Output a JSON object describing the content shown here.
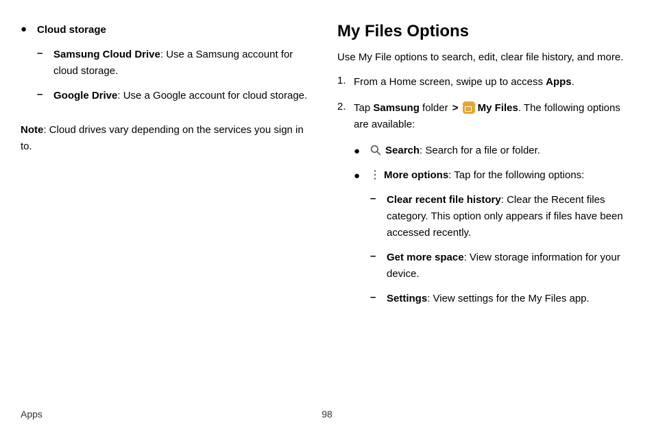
{
  "left": {
    "cloudStorage": {
      "heading": "Cloud storage",
      "items": [
        {
          "bold": "Samsung Cloud Drive",
          "rest": ": Use a Samsung account for cloud storage."
        },
        {
          "bold": "Google Drive",
          "rest": ": Use a Google account for cloud storage."
        }
      ]
    },
    "note": {
      "bold": "Note",
      "rest": ": Cloud drives vary depending on the services you sign in to."
    }
  },
  "right": {
    "heading": "My Files Options",
    "intro": "Use My File options to search, edit, clear file history, and more.",
    "step1": {
      "prefix": "From a Home screen, swipe up to access ",
      "bold": "Apps",
      "suffix": "."
    },
    "step2": {
      "tap": "Tap ",
      "samsung": "Samsung",
      "folder": " folder ",
      "chevron": ">",
      "myfiles": "My Files",
      "suffix": ". The following options are available:"
    },
    "options": {
      "search": {
        "bold": "Search",
        "rest": ": Search for a file or folder."
      },
      "more": {
        "bold": "More options",
        "rest": ": Tap for the following options:"
      },
      "moreItems": [
        {
          "bold": "Clear recent file history",
          "rest": ": Clear the Recent files category. This option only appears if files have been accessed recently."
        },
        {
          "bold": "Get more space",
          "rest": ": View storage information for your device."
        },
        {
          "bold": "Settings",
          "rest": ": View settings for the My Files app."
        }
      ]
    }
  },
  "footer": {
    "label": "Apps",
    "page": "98"
  }
}
